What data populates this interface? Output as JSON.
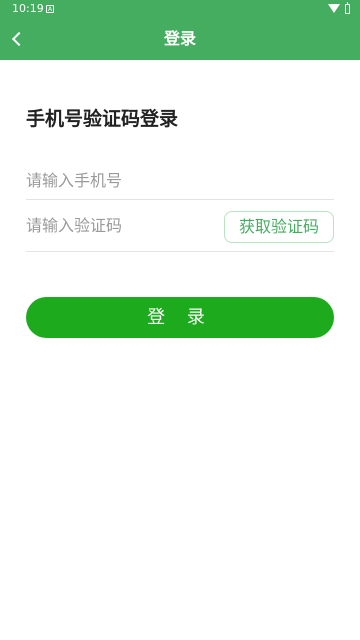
{
  "status_bar": {
    "time": "10:19",
    "notification_glyph": "A"
  },
  "app_bar": {
    "back_icon": "chevron-left-icon",
    "title": "登录"
  },
  "page": {
    "heading": "手机号验证码登录"
  },
  "form": {
    "phone_placeholder": "请输入手机号",
    "phone_value": "",
    "code_placeholder": "请输入验证码",
    "code_value": "",
    "get_code_label": "获取验证码",
    "login_label": "登 录"
  },
  "colors": {
    "header": "#45ad5f",
    "primary_button": "#1dab1d",
    "code_button_text": "#45ad5f",
    "code_button_border": "#b9e2c1"
  }
}
